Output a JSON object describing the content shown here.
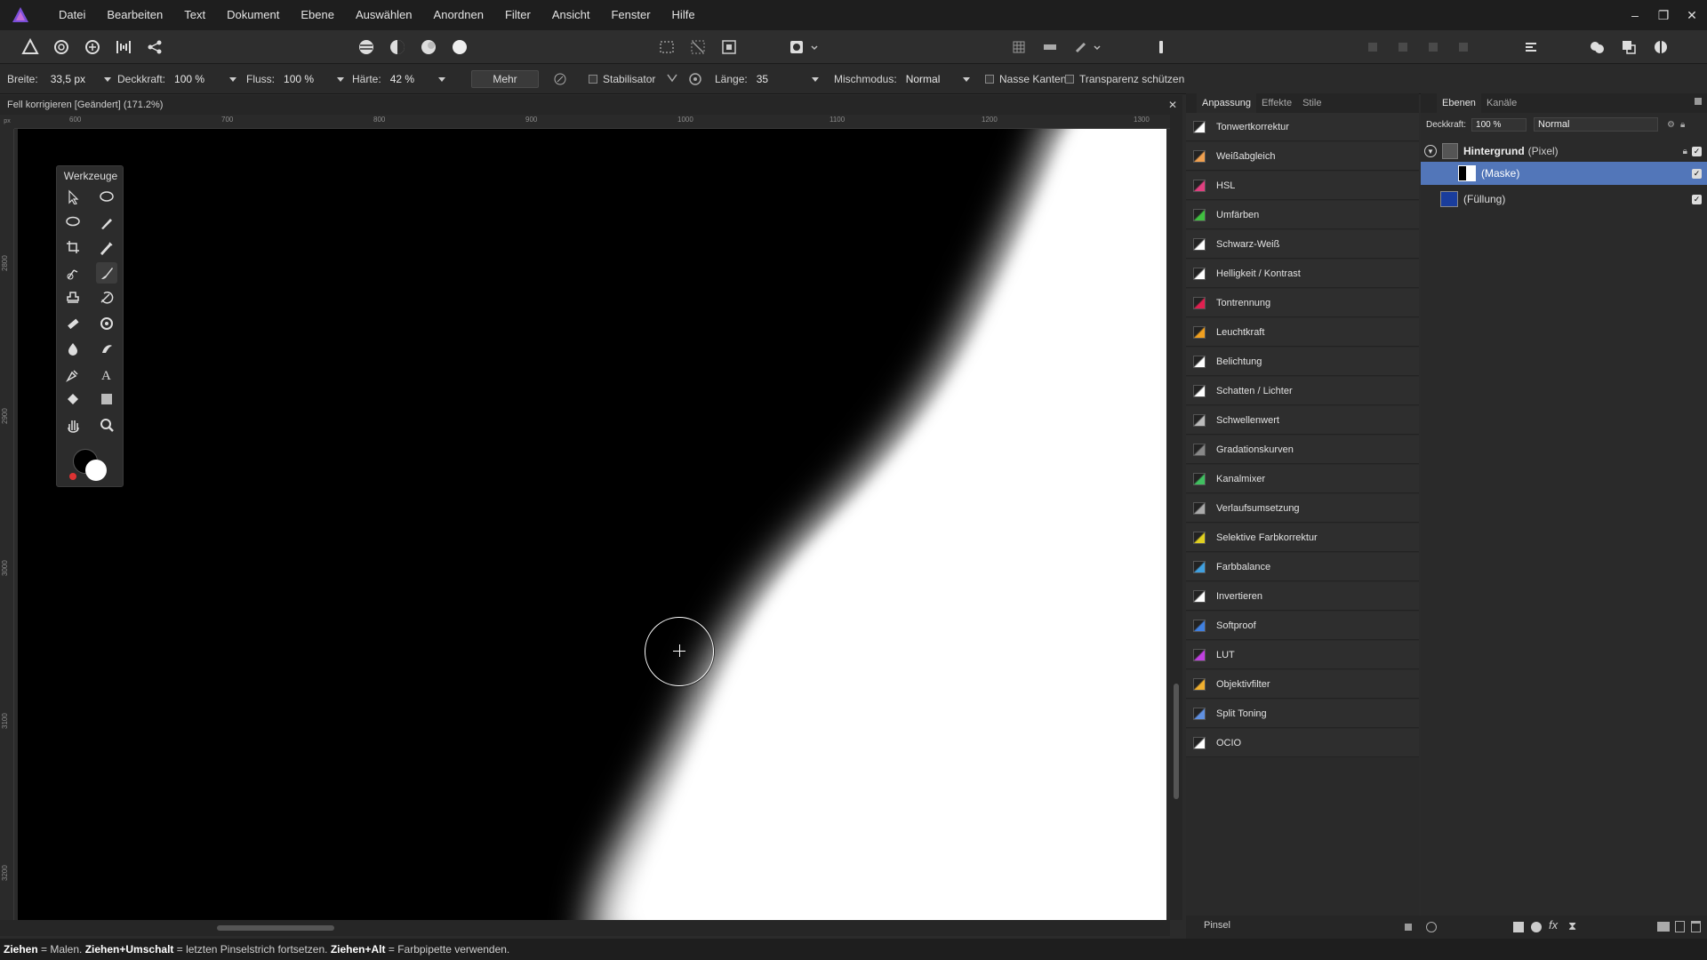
{
  "menu": [
    "Datei",
    "Bearbeiten",
    "Text",
    "Dokument",
    "Ebene",
    "Auswählen",
    "Anordnen",
    "Filter",
    "Ansicht",
    "Fenster",
    "Hilfe"
  ],
  "window_controls": {
    "minimize": "–",
    "restore": "❐",
    "close": "✕"
  },
  "context": {
    "width_label": "Breite:",
    "width_value": "33,5 px",
    "opacity_label": "Deckkraft:",
    "opacity_value": "100 %",
    "flow_label": "Fluss:",
    "flow_value": "100 %",
    "hardness_label": "Härte:",
    "hardness_value": "42 %",
    "more_label": "Mehr",
    "stabilizer_label": "Stabilisator",
    "length_label": "Länge:",
    "length_value": "35",
    "blend_label": "Mischmodus:",
    "blend_value": "Normal",
    "wet_edges_label": "Nasse Kanten",
    "protect_alpha_label": "Transparenz schützen"
  },
  "document": {
    "title": "Fell korrigieren [Geändert] (171.2%)",
    "close": "✕",
    "ruler_unit": "px",
    "hruler_labels": [
      "600",
      "700",
      "800",
      "900",
      "1000",
      "1100",
      "1200",
      "1300"
    ],
    "vruler_labels": [
      "2800",
      "2900",
      "3000",
      "3100",
      "3200"
    ]
  },
  "tools_panel": {
    "title": "Werkzeuge",
    "tools": [
      {
        "name": "move-tool-icon",
        "active": false
      },
      {
        "name": "freehand-selection-icon",
        "active": false
      },
      {
        "name": "lasso-tool-icon",
        "active": false
      },
      {
        "name": "selection-brush-icon",
        "active": false
      },
      {
        "name": "crop-tool-icon",
        "active": false
      },
      {
        "name": "color-picker-icon",
        "active": false
      },
      {
        "name": "flood-select-icon",
        "active": false
      },
      {
        "name": "paint-brush-icon",
        "active": true
      },
      {
        "name": "clone-tool-icon",
        "active": false
      },
      {
        "name": "undo-brush-icon",
        "active": false
      },
      {
        "name": "healing-brush-icon",
        "active": false
      },
      {
        "name": "dodge-tool-icon",
        "active": false
      },
      {
        "name": "blur-brush-icon",
        "active": false
      },
      {
        "name": "smudge-brush-icon",
        "active": false
      },
      {
        "name": "pen-tool-icon",
        "active": false
      },
      {
        "name": "text-tool-icon",
        "active": false
      },
      {
        "name": "fill-tool-icon",
        "active": false
      },
      {
        "name": "rectangle-tool-icon",
        "active": false
      },
      {
        "name": "hand-tool-icon",
        "active": false
      },
      {
        "name": "zoom-tool-icon",
        "active": false
      }
    ]
  },
  "adjustments": {
    "tabs": [
      "Anpassung",
      "Effekte",
      "Stile"
    ],
    "items": [
      {
        "label": "Tonwertkorrektur",
        "color": "#ffffff"
      },
      {
        "label": "Weißabgleich",
        "color": "#f0a050"
      },
      {
        "label": "HSL",
        "color": "#e04080"
      },
      {
        "label": "Umfärben",
        "color": "#40c040"
      },
      {
        "label": "Schwarz-Weiß",
        "color": "#ffffff"
      },
      {
        "label": "Helligkeit / Kontrast",
        "color": "#ffffff"
      },
      {
        "label": "Tontrennung",
        "color": "#e02050"
      },
      {
        "label": "Leuchtkraft",
        "color": "#f0a020"
      },
      {
        "label": "Belichtung",
        "color": "#ffffff"
      },
      {
        "label": "Schatten / Lichter",
        "color": "#ffffff"
      },
      {
        "label": "Schwellenwert",
        "color": "#bbbbbb"
      },
      {
        "label": "Gradationskurven",
        "color": "#888888"
      },
      {
        "label": "Kanalmixer",
        "color": "#40c060"
      },
      {
        "label": "Verlaufsumsetzung",
        "color": "#aaaaaa"
      },
      {
        "label": "Selektive Farbkorrektur",
        "color": "#e0d020"
      },
      {
        "label": "Farbbalance",
        "color": "#40a0e0"
      },
      {
        "label": "Invertieren",
        "color": "#ffffff"
      },
      {
        "label": "Softproof",
        "color": "#4080e0"
      },
      {
        "label": "LUT",
        "color": "#c040e0"
      },
      {
        "label": "Objektivfilter",
        "color": "#f0b030"
      },
      {
        "label": "Split Toning",
        "color": "#6090e0"
      },
      {
        "label": "OCIO",
        "color": "#ffffff"
      }
    ]
  },
  "layers": {
    "tabs": [
      "Ebenen",
      "Kanäle"
    ],
    "opacity_label": "Deckkraft:",
    "opacity_value": "100 %",
    "blend_value": "Normal",
    "items": [
      {
        "name": "Hintergrund",
        "type": "(Pixel)"
      },
      {
        "name": "(Maske)"
      },
      {
        "name": "(Füllung)"
      }
    ],
    "fill_color": "#1a3d9c"
  },
  "bottom_panel": {
    "brush_label": "Pinsel"
  },
  "status": {
    "drag": "Ziehen",
    "drag_text": " = Malen. ",
    "drag_shift": "Ziehen+Umschalt",
    "drag_shift_text": " = letzten Pinselstrich fortsetzen. ",
    "drag_alt": "Ziehen+Alt",
    "drag_alt_text": " = Farbpipette verwenden."
  }
}
